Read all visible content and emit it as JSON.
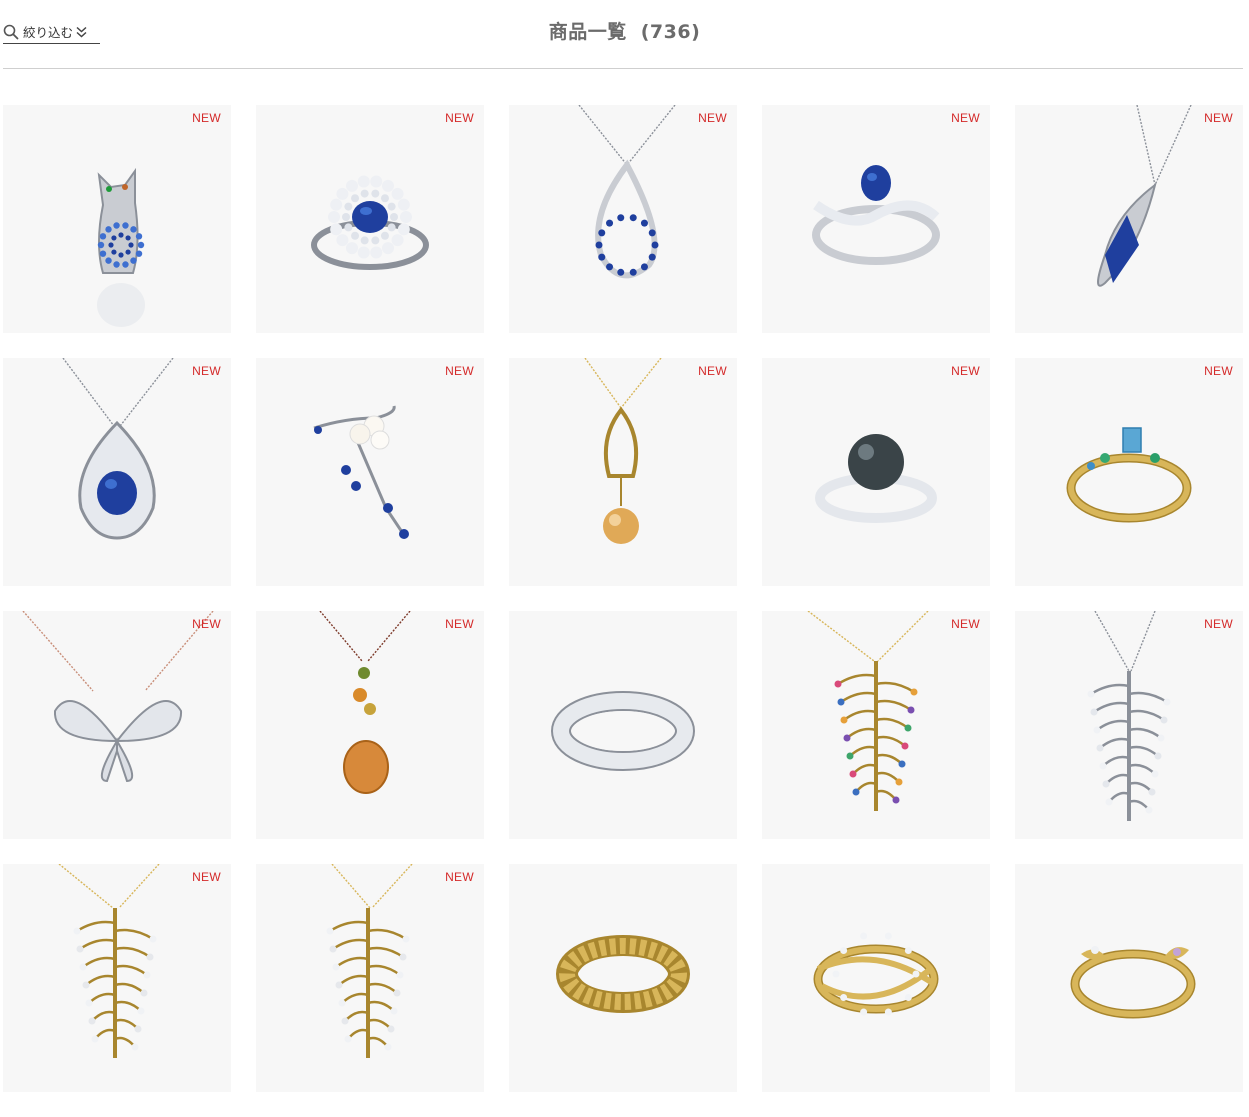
{
  "header": {
    "filter_label": "絞り込む",
    "title": "商品一覧",
    "count": "(736)"
  },
  "colors": {
    "badge": "#d42a2a",
    "card_bg": "#f7f7f7",
    "divider": "#cfcfcf"
  },
  "products": [
    {
      "type": "cat-pendant",
      "badge": "NEW"
    },
    {
      "type": "sapphire-halo-ring",
      "badge": "NEW"
    },
    {
      "type": "teardrop-necklace",
      "badge": "NEW"
    },
    {
      "type": "sapphire-wave-ring",
      "badge": "NEW"
    },
    {
      "type": "marquise-sapphire-pendant",
      "badge": "NEW"
    },
    {
      "type": "sapphire-drop-pendant",
      "badge": "NEW"
    },
    {
      "type": "pearl-vine-brooch",
      "badge": "NEW"
    },
    {
      "type": "golden-pearl-pendant",
      "badge": "NEW"
    },
    {
      "type": "black-pearl-ring",
      "badge": "NEW"
    },
    {
      "type": "topaz-gold-ring",
      "badge": "NEW"
    },
    {
      "type": "butterfly-necklace",
      "badge": "NEW"
    },
    {
      "type": "citrine-pendant",
      "badge": "NEW"
    },
    {
      "type": "silver-band-ring",
      "badge": ""
    },
    {
      "type": "gold-branch-multistone-pendant",
      "badge": "NEW"
    },
    {
      "type": "silver-branch-pendant",
      "badge": "NEW"
    },
    {
      "type": "gold-branch-pendant",
      "badge": "NEW"
    },
    {
      "type": "gold-branch-pendant-2",
      "badge": "NEW"
    },
    {
      "type": "gold-lattice-ring",
      "badge": ""
    },
    {
      "type": "gold-vine-ring",
      "badge": ""
    },
    {
      "type": "gold-leaf-ring",
      "badge": ""
    }
  ]
}
